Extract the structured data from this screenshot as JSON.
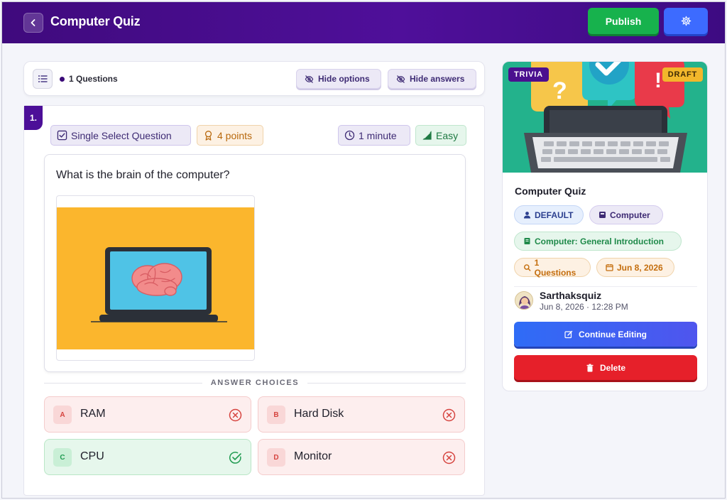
{
  "header": {
    "title": "Computer Quiz",
    "publish_label": "Publish",
    "back_icon": "chevron-left-icon",
    "settings_icon": "gear-icon"
  },
  "toolbar": {
    "question_count": "1 Questions",
    "hide_options_label": "Hide options",
    "hide_answers_label": "Hide answers"
  },
  "question": {
    "number": "1.",
    "type_label": "Single Select Question",
    "points_label": "4 points",
    "time_label": "1 minute",
    "difficulty_label": "Easy",
    "text": "What is the brain of the computer?",
    "image_description_icon": "laptop-brain-illustration",
    "answers_heading": "ANSWER CHOICES",
    "choices": [
      {
        "letter": "A",
        "text": "RAM",
        "correct": false
      },
      {
        "letter": "B",
        "text": "Hard Disk",
        "correct": false
      },
      {
        "letter": "C",
        "text": "CPU",
        "correct": true
      },
      {
        "letter": "D",
        "text": "Monitor",
        "correct": false
      }
    ]
  },
  "quiz_card": {
    "badge_left": "TRIVIA",
    "badge_right": "DRAFT",
    "title": "Computer Quiz",
    "chips": {
      "default": "DEFAULT",
      "category": "Computer",
      "topic": "Computer: General Introduction",
      "question_count": "1 Questions",
      "date": "Jun 8, 2026"
    },
    "author": {
      "name": "Sarthaksquiz",
      "meta": "Jun 8, 2026 · 12:28 PM"
    },
    "continue_label": "Continue Editing",
    "delete_label": "Delete"
  },
  "colors": {
    "header_purple": "#4f0f9a",
    "publish_green": "#17b24d",
    "settings_blue": "#3d6bff",
    "correct_green": "#209b51",
    "wrong_red": "#d6443f",
    "delete_red": "#e6202a",
    "cover_teal": "#23b28c",
    "image_yellow": "#fbb62d"
  }
}
